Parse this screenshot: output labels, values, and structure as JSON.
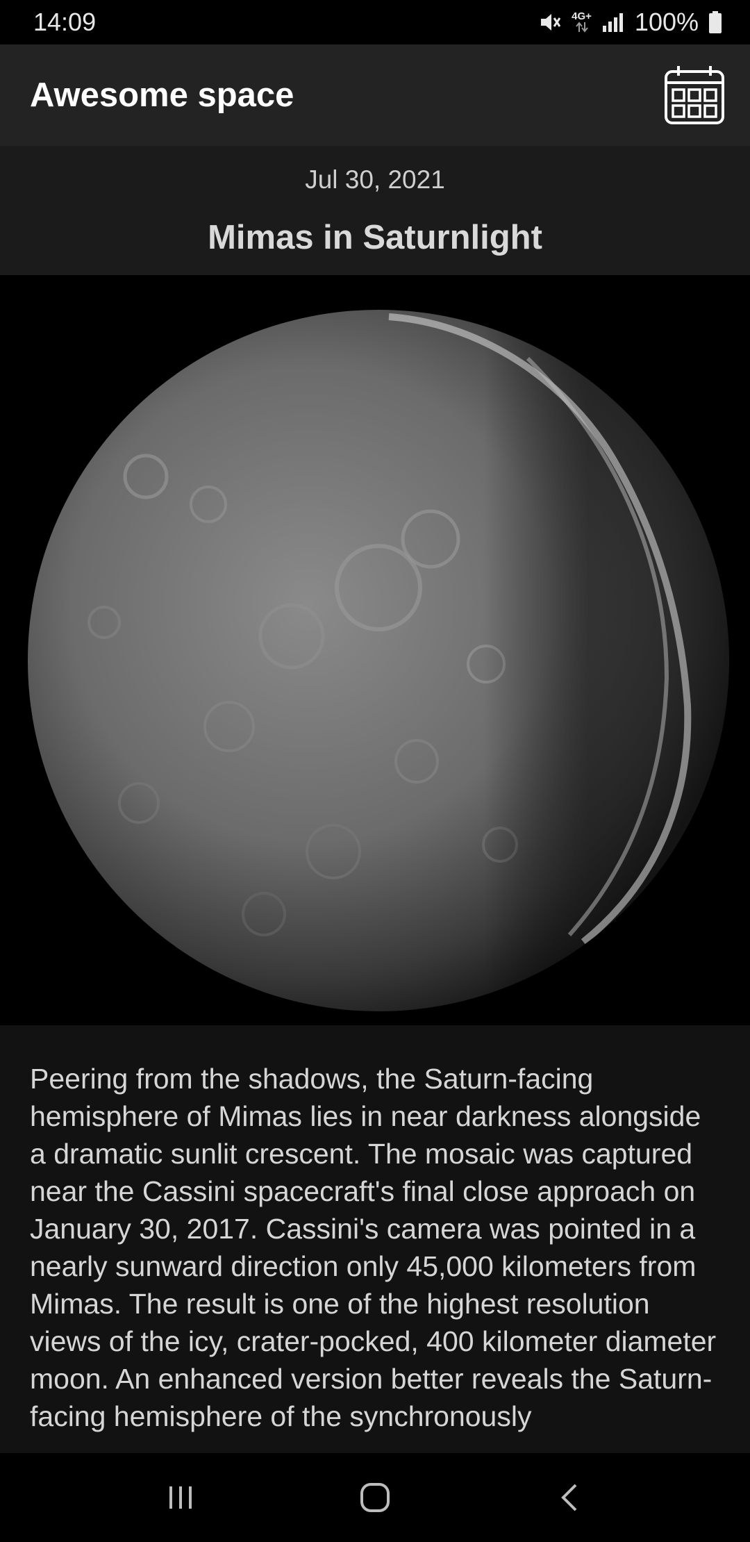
{
  "status_bar": {
    "time": "14:09",
    "network": "4G+",
    "battery": "100%",
    "icons": [
      "mute-icon",
      "network-4g-icon",
      "signal-icon",
      "battery-icon"
    ]
  },
  "app_bar": {
    "title": "Awesome space",
    "action_icon": "calendar-icon"
  },
  "apod": {
    "date": "Jul 30, 2021",
    "title": "Mimas in Saturnlight",
    "explanation": "Peering from the shadows, the Saturn-facing hemisphere of Mimas lies in near darkness alongside a dramatic sunlit crescent. The mosaic was captured near the Cassini spacecraft's final close approach on January 30, 2017. Cassini's camera was pointed in a nearly sunward direction only 45,000 kilometers from Mimas. The result is one of the highest resolution views of the icy, crater-pocked, 400 kilometer diameter moon. An enhanced version better reveals the Saturn-facing hemisphere of the synchronously"
  },
  "nav_bar": {
    "icons": [
      "recent-apps-icon",
      "home-icon",
      "back-icon"
    ]
  },
  "colors": {
    "status_bar_bg": "#000000",
    "app_bar_bg": "#232323",
    "header_bg": "#1b1b1b",
    "body_bg": "#121212"
  }
}
